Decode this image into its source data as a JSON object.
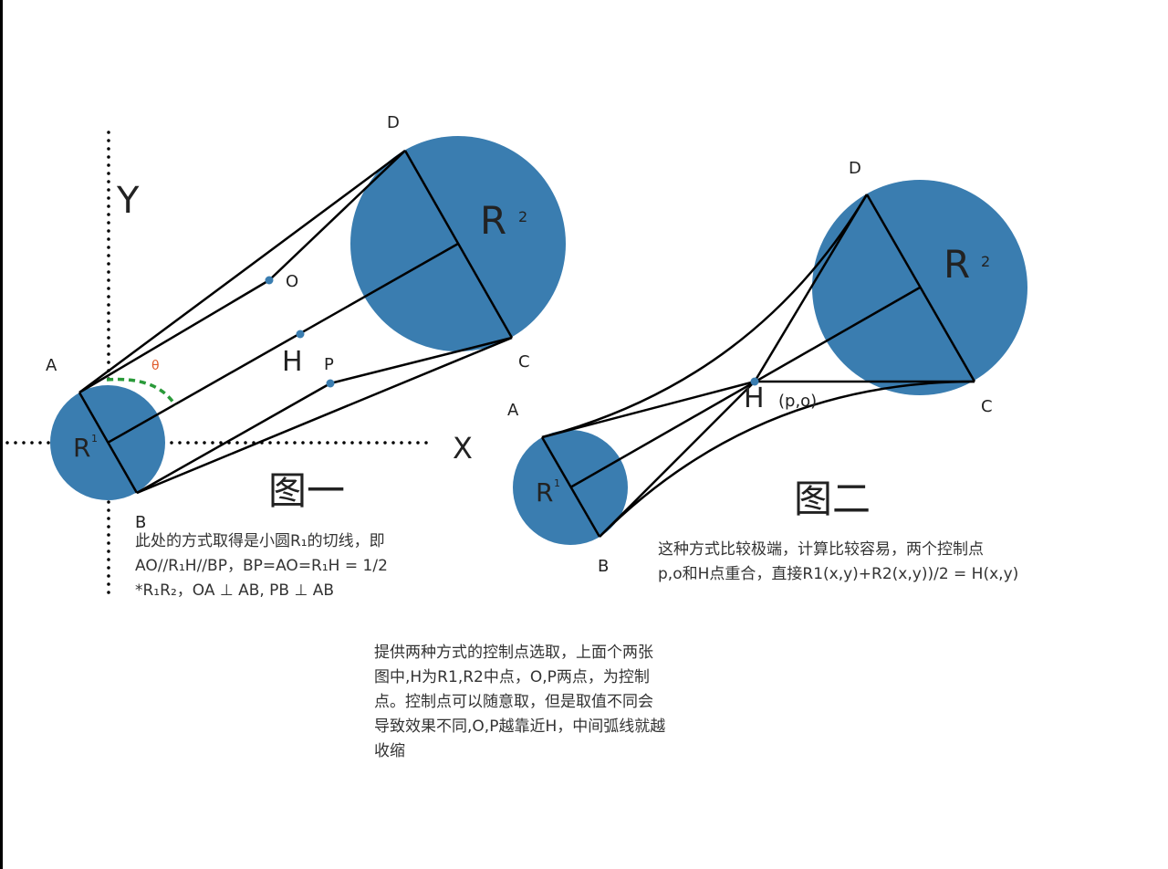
{
  "colors": {
    "circle_fill": "#3a7db0",
    "point": "#3a7db0",
    "line": "#000000",
    "angle_arc": "#2a9a3a",
    "theta_label": "#e05a2a",
    "text": "#333333"
  },
  "figure1": {
    "title": "图一",
    "axis_y_label": "Y",
    "axis_x_label": "X",
    "circle_small_label": "R",
    "circle_small_sub": "1",
    "circle_big_label": "R",
    "circle_big_sub": "2",
    "points": {
      "A": "A",
      "B": "B",
      "C": "C",
      "D": "D",
      "H": "H",
      "O": "O",
      "P": "P"
    },
    "theta": "θ",
    "caption": [
      "此处的方式取得是小圆R₁的切线，即",
      "AO//R₁H//BP，BP=AO=R₁H = 1/2",
      "*R₁R₂，OA ⊥ AB, PB ⊥ AB"
    ]
  },
  "figure2": {
    "title": "图二",
    "circle_small_label": "R",
    "circle_small_sub": "1",
    "circle_big_label": "R",
    "circle_big_sub": "2",
    "points": {
      "A": "A",
      "B": "B",
      "C": "C",
      "D": "D",
      "H": "H"
    },
    "h_coord": "(p,o)",
    "caption": [
      "这种方式比较极端，计算比较容易，两个控制点",
      "p,o和H点重合，直接R1(x,y)+R2(x,y))/2 = H(x,y)"
    ]
  },
  "bottom_note": [
    "提供两种方式的控制点选取，上面个两张",
    "图中,H为R1,R2中点，O,P两点，为控制",
    "点。控制点可以随意取，但是取值不同会",
    "导致效果不同,O,P越靠近H，中间弧线就越",
    "收缩"
  ]
}
